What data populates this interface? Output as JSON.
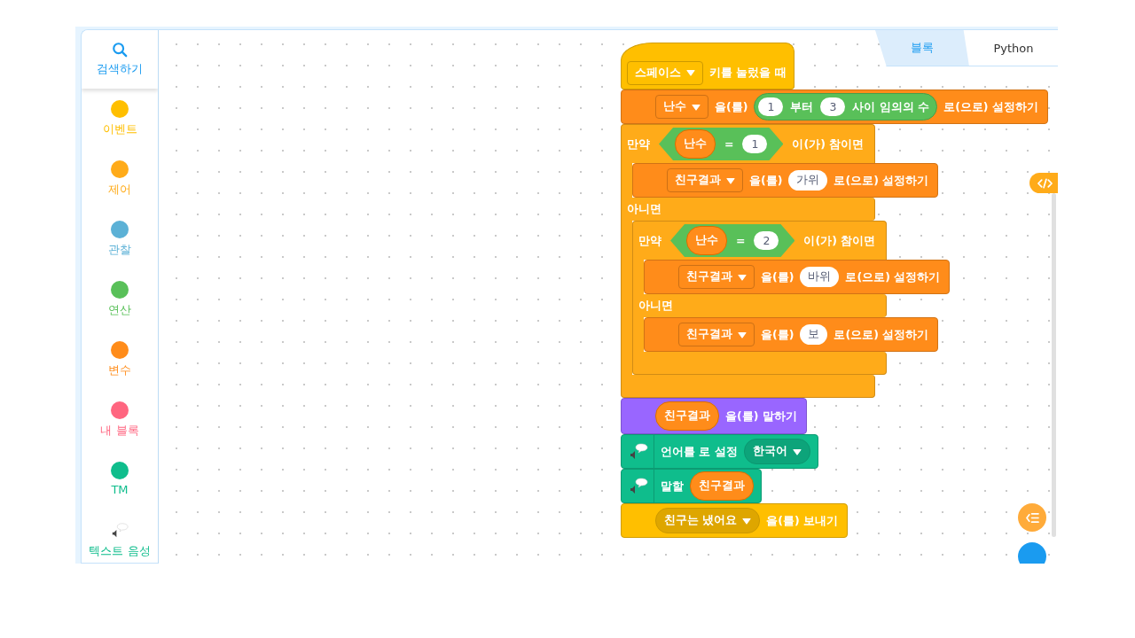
{
  "sidebar": {
    "search_label": "검색하기",
    "categories": [
      {
        "kind": "dot",
        "label": "이벤트",
        "color": "#ffbf00"
      },
      {
        "kind": "dot",
        "label": "제어",
        "color": "#ffab19"
      },
      {
        "kind": "dot",
        "label": "관찰",
        "color": "#5cb1d6"
      },
      {
        "kind": "dot",
        "label": "연산",
        "color": "#59c059"
      },
      {
        "kind": "dot",
        "label": "변수",
        "color": "#ff8c1a"
      },
      {
        "kind": "dot",
        "label": "내 블록",
        "color": "#ff6680"
      },
      {
        "kind": "dot",
        "label": "TM",
        "color": "#0fbd8c"
      },
      {
        "kind": "speech",
        "label": "텍스트 음성",
        "color": "#0fbd8c"
      }
    ]
  },
  "tabs": [
    {
      "label": "블록",
      "selected": true
    },
    {
      "label": "Python",
      "selected": false
    }
  ],
  "script": [
    {
      "kind": "hat",
      "color": "#ffbf00",
      "parts": [
        {
          "kind": "dropdown",
          "text": "스페이스"
        },
        {
          "kind": "text",
          "text": "키를 눌렀을 때"
        }
      ]
    },
    {
      "kind": "stack",
      "color": "#ff8c1a",
      "parts": [
        {
          "kind": "dropdown",
          "text": "난수"
        },
        {
          "kind": "text",
          "text": "을(를)"
        },
        {
          "kind": "reporter",
          "color": "#59c059",
          "parts": [
            {
              "kind": "input",
              "text": "1"
            },
            {
              "kind": "text",
              "text": "부터"
            },
            {
              "kind": "input",
              "text": "3"
            },
            {
              "kind": "text",
              "text": "사이 임의의 수"
            }
          ]
        },
        {
          "kind": "text",
          "text": "로(으로) 설정하기"
        }
      ]
    },
    {
      "kind": "if_else",
      "color": "#ffab19",
      "head": [
        {
          "kind": "text",
          "text": "만약"
        },
        {
          "kind": "boolean",
          "color": "#59c059",
          "parts": [
            {
              "kind": "variable",
              "text": "난수"
            },
            {
              "kind": "text",
              "text": "="
            },
            {
              "kind": "input",
              "text": "1"
            }
          ]
        },
        {
          "kind": "text",
          "text": "이(가) 참이면"
        }
      ],
      "then": [
        {
          "kind": "stack",
          "color": "#ff8c1a",
          "parts": [
            {
              "kind": "dropdown",
              "text": "친구결과"
            },
            {
              "kind": "text",
              "text": "을(를)"
            },
            {
              "kind": "input",
              "text": "가위"
            },
            {
              "kind": "text",
              "text": "로(으로) 설정하기"
            }
          ]
        }
      ],
      "else_head": [
        {
          "kind": "text",
          "text": "아니면"
        }
      ],
      "else": [
        {
          "kind": "if_else",
          "color": "#ffab19",
          "head": [
            {
              "kind": "text",
              "text": "만약"
            },
            {
              "kind": "boolean",
              "color": "#59c059",
              "parts": [
                {
                  "kind": "variable",
                  "text": "난수"
                },
                {
                  "kind": "text",
                  "text": "="
                },
                {
                  "kind": "input",
                  "text": "2"
                }
              ]
            },
            {
              "kind": "text",
              "text": "이(가) 참이면"
            }
          ],
          "then": [
            {
              "kind": "stack",
              "color": "#ff8c1a",
              "parts": [
                {
                  "kind": "dropdown",
                  "text": "친구결과"
                },
                {
                  "kind": "text",
                  "text": "을(를)"
                },
                {
                  "kind": "input",
                  "text": "바위"
                },
                {
                  "kind": "text",
                  "text": "로(으로) 설정하기"
                }
              ]
            }
          ],
          "else_head": [
            {
              "kind": "text",
              "text": "아니면"
            }
          ],
          "else": [
            {
              "kind": "stack",
              "color": "#ff8c1a",
              "parts": [
                {
                  "kind": "dropdown",
                  "text": "친구결과"
                },
                {
                  "kind": "text",
                  "text": "을(를)"
                },
                {
                  "kind": "input",
                  "text": "보"
                },
                {
                  "kind": "text",
                  "text": "로(으로) 설정하기"
                }
              ]
            }
          ]
        }
      ]
    },
    {
      "kind": "stack",
      "color": "#9966ff",
      "parts": [
        {
          "kind": "variable",
          "text": "친구결과"
        },
        {
          "kind": "text",
          "text": "을(를) 말하기"
        }
      ]
    },
    {
      "kind": "extension",
      "color": "#0fbd8c",
      "parts": [
        {
          "kind": "text",
          "text": "언어를 로 설정"
        },
        {
          "kind": "pill_dropdown",
          "text": "한국어"
        }
      ]
    },
    {
      "kind": "extension",
      "color": "#0fbd8c",
      "parts": [
        {
          "kind": "text",
          "text": "말할"
        },
        {
          "kind": "variable",
          "text": "친구결과"
        }
      ]
    },
    {
      "kind": "stack",
      "color": "#ffbf00",
      "parts": [
        {
          "kind": "pill_dropdown",
          "text": "친구는 냈어요"
        },
        {
          "kind": "text",
          "text": "을(를) 보내기"
        }
      ]
    }
  ]
}
